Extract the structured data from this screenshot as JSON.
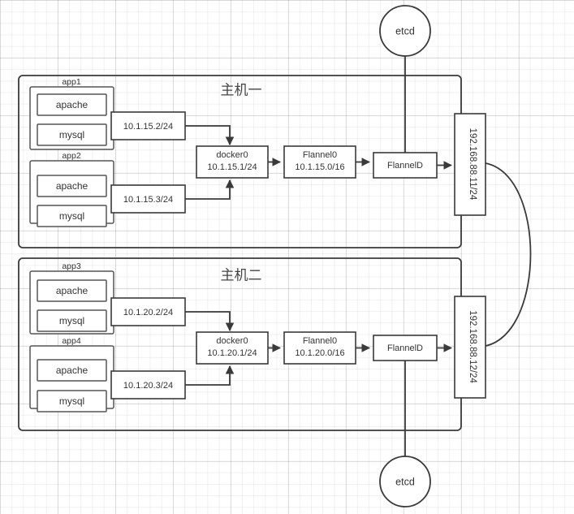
{
  "diagram": {
    "title_absent": true,
    "external_nodes": [
      {
        "id": "etcd-top",
        "label": "etcd",
        "shape": "circle"
      },
      {
        "id": "etcd-bottom",
        "label": "etcd",
        "shape": "circle"
      }
    ],
    "hosts": [
      {
        "id": "host1",
        "title": "主机一",
        "apps": [
          {
            "name": "app1",
            "services": [
              "apache",
              "mysql"
            ],
            "ip": "10.1.15.2/24"
          },
          {
            "name": "app2",
            "services": [
              "apache",
              "mysql"
            ],
            "ip": "10.1.15.3/24"
          }
        ],
        "bridge": {
          "name": "docker0",
          "ip": "10.1.15.1/24"
        },
        "flannel_iface": {
          "name": "Flannel0",
          "ip": "10.1.15.0/16"
        },
        "flannel_daemon": {
          "name": "FlannelD"
        },
        "host_nic": {
          "ip": "192.168.88.11/24"
        }
      },
      {
        "id": "host2",
        "title": "主机二",
        "apps": [
          {
            "name": "app3",
            "services": [
              "apache",
              "mysql"
            ],
            "ip": "10.1.20.2/24"
          },
          {
            "name": "app4",
            "services": [
              "apache",
              "mysql"
            ],
            "ip": "10.1.20.3/24"
          }
        ],
        "bridge": {
          "name": "docker0",
          "ip": "10.1.20.1/24"
        },
        "flannel_iface": {
          "name": "Flannel0",
          "ip": "10.1.20.0/16"
        },
        "flannel_daemon": {
          "name": "FlannelD"
        },
        "host_nic": {
          "ip": "192.168.88.12/24"
        }
      }
    ],
    "colors": {
      "stroke": "#3a3a3a",
      "inner_stroke": "#555555",
      "text": "#333333",
      "background": "#ffffff",
      "grid_minor": "#f0f0f0",
      "grid_major": "#e4e4e4"
    }
  }
}
